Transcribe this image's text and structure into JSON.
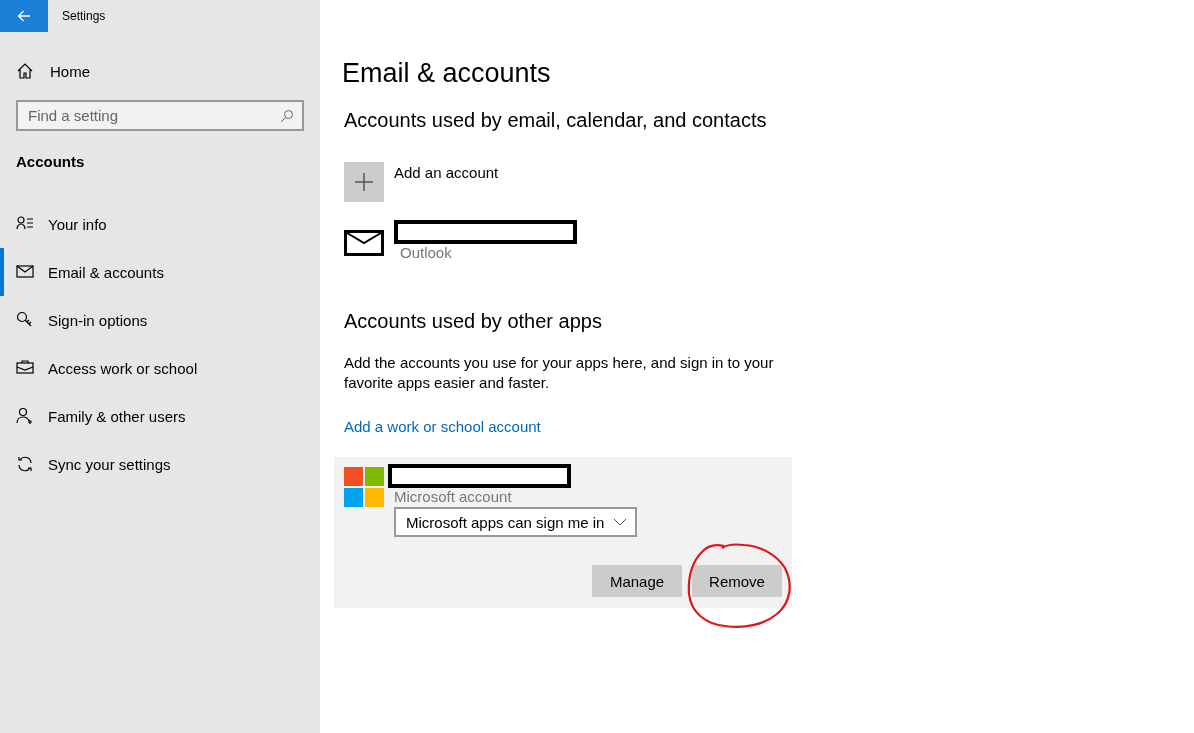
{
  "window": {
    "title": "Settings"
  },
  "sidebar": {
    "home": "Home",
    "search": {
      "placeholder": "Find a setting"
    },
    "heading": "Accounts",
    "items": [
      {
        "label": "Your info",
        "selected": false
      },
      {
        "label": "Email & accounts",
        "selected": true
      },
      {
        "label": "Sign-in options",
        "selected": false
      },
      {
        "label": "Access work or school",
        "selected": false
      },
      {
        "label": "Family & other users",
        "selected": false
      },
      {
        "label": "Sync your settings",
        "selected": false
      }
    ]
  },
  "page": {
    "title": "Email & accounts",
    "email_section": {
      "heading": "Accounts used by email, calendar, and contacts",
      "items": [
        {
          "kind": "add",
          "label": "Add an account"
        },
        {
          "kind": "account",
          "provider": "Outlook"
        }
      ]
    },
    "apps_section": {
      "heading": "Accounts used by other apps",
      "description": "Add the accounts you use for your apps here, and sign in to your favorite apps easier and faster.",
      "link": "Add a work or school account",
      "account": {
        "type": "Microsoft account",
        "dropdown": "Microsoft apps can sign me in",
        "buttons": [
          "Manage",
          "Remove"
        ]
      }
    }
  }
}
